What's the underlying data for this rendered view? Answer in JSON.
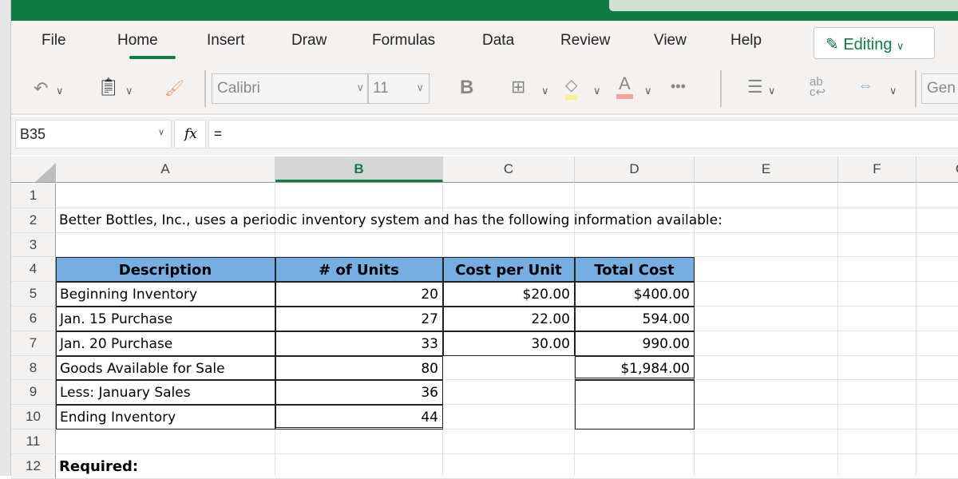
{
  "ribbon": {
    "tabs": [
      "File",
      "Home",
      "Insert",
      "Draw",
      "Formulas",
      "Data",
      "Review",
      "View",
      "Help"
    ],
    "active_tab": "Home",
    "mode_button": "Editing",
    "font_name": "Calibri",
    "font_size": "11",
    "bold_label": "B",
    "number_format": "Gen"
  },
  "formula_bar": {
    "name_box": "B35",
    "fx_label": "fx",
    "formula": "="
  },
  "columns": [
    "A",
    "B",
    "C",
    "D",
    "E",
    "F",
    "G"
  ],
  "selected_column": "B",
  "rows": [
    "1",
    "2",
    "3",
    "4",
    "5",
    "6",
    "7",
    "8",
    "9",
    "10",
    "11",
    "12"
  ],
  "sheet": {
    "title_text": "Better Bottles, Inc., uses a periodic inventory system and has the following information available:",
    "headers": [
      "Description",
      "# of Units",
      "Cost per Unit",
      "Total Cost"
    ],
    "table": [
      [
        "Beginning Inventory",
        "20",
        "$20.00",
        "$400.00"
      ],
      [
        "Jan. 15 Purchase",
        "27",
        "22.00",
        "594.00"
      ],
      [
        "Jan. 20 Purchase",
        "33",
        "30.00",
        "990.00"
      ],
      [
        "Goods Available for Sale",
        "80",
        "",
        "$1,984.00"
      ],
      [
        "Less: January Sales",
        "36",
        "",
        ""
      ],
      [
        "Ending Inventory",
        "44",
        "",
        ""
      ]
    ],
    "required_label": "Required:"
  },
  "colors": {
    "brand": "#107c41",
    "header_fill": "#76aee2"
  }
}
